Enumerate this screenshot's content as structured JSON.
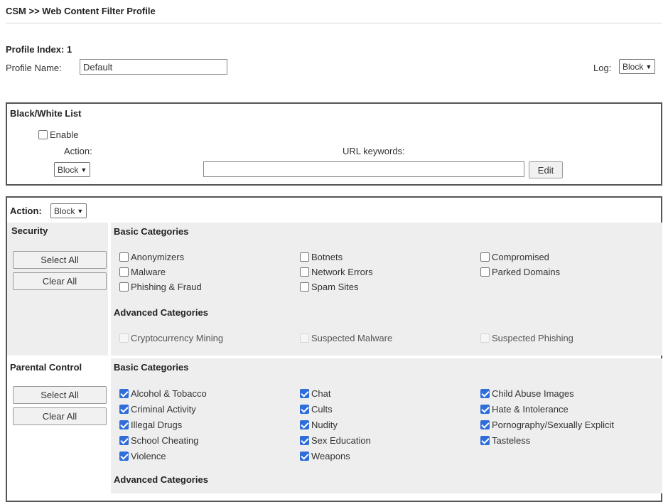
{
  "header": {
    "title": "CSM >> Web Content Filter Profile"
  },
  "profile": {
    "index_label": "Profile Index: 1",
    "name_label": "Profile Name:",
    "name_value": "Default",
    "log_label": "Log:",
    "log_value": "Block"
  },
  "bwlist": {
    "title": "Black/White List",
    "enable_label": "Enable",
    "action_label": "Action:",
    "url_label": "URL keywords:",
    "action_value": "Block",
    "url_value": "",
    "edit_label": "Edit"
  },
  "filter": {
    "action_label": "Action:",
    "action_value": "Block",
    "security": {
      "title": "Security",
      "select_all": "Select All",
      "clear_all": "Clear All",
      "basic_title": "Basic Categories",
      "basic": [
        {
          "label": "Anonymizers",
          "checked": false
        },
        {
          "label": "Botnets",
          "checked": false
        },
        {
          "label": "Compromised",
          "checked": false
        },
        {
          "label": "Malware",
          "checked": false
        },
        {
          "label": "Network Errors",
          "checked": false
        },
        {
          "label": "Parked Domains",
          "checked": false
        },
        {
          "label": "Phishing & Fraud",
          "checked": false
        },
        {
          "label": "Spam Sites",
          "checked": false
        }
      ],
      "advanced_title": "Advanced Categories",
      "advanced": [
        {
          "label": "Cryptocurrency Mining",
          "checked": false,
          "disabled": true
        },
        {
          "label": "Suspected Malware",
          "checked": false,
          "disabled": true
        },
        {
          "label": "Suspected Phishing",
          "checked": false,
          "disabled": true
        }
      ]
    },
    "parental": {
      "title": "Parental Control",
      "select_all": "Select All",
      "clear_all": "Clear All",
      "basic_title": "Basic Categories",
      "basic": [
        {
          "label": "Alcohol & Tobacco",
          "checked": true
        },
        {
          "label": "Chat",
          "checked": true
        },
        {
          "label": "Child Abuse Images",
          "checked": true
        },
        {
          "label": "Criminal Activity",
          "checked": true
        },
        {
          "label": "Cults",
          "checked": true
        },
        {
          "label": "Hate & Intolerance",
          "checked": true
        },
        {
          "label": "Illegal Drugs",
          "checked": true
        },
        {
          "label": "Nudity",
          "checked": true
        },
        {
          "label": "Pornography/Sexually Explicit",
          "checked": true
        },
        {
          "label": "School Cheating",
          "checked": true
        },
        {
          "label": "Sex Education",
          "checked": true
        },
        {
          "label": "Tasteless",
          "checked": true
        },
        {
          "label": "Violence",
          "checked": true
        },
        {
          "label": "Weapons",
          "checked": true
        }
      ],
      "advanced_title": "Advanced Categories"
    }
  },
  "colors": {
    "checkbox_checked": "#2f6ed8",
    "section_shade": "#eeeeee",
    "border": "#555555"
  }
}
